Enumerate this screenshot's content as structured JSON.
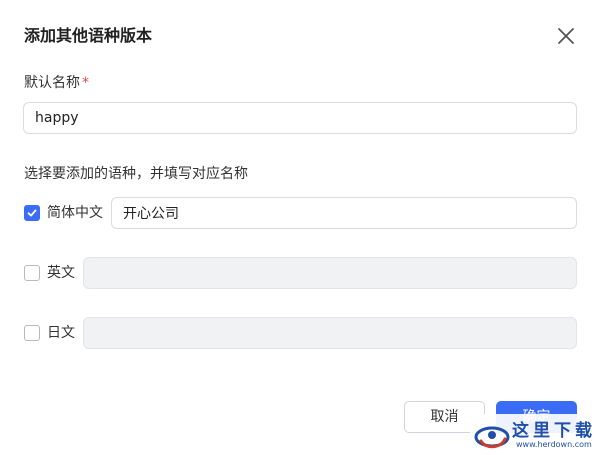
{
  "dialog": {
    "title": "添加其他语种版本",
    "close_icon": "close-icon"
  },
  "default_name": {
    "label": "默认名称",
    "required_mark": "*",
    "value": "happy"
  },
  "languages_section": {
    "instruction": "选择要添加的语种，并填写对应名称",
    "items": [
      {
        "label": "简体中文",
        "checked": true,
        "value": "开心公司",
        "disabled": false
      },
      {
        "label": "英文",
        "checked": false,
        "value": "",
        "disabled": true
      },
      {
        "label": "日文",
        "checked": false,
        "value": "",
        "disabled": true
      }
    ]
  },
  "footer": {
    "cancel_label": "取消",
    "ok_label": "确定"
  },
  "watermark": {
    "text": "这里下载",
    "url": "www.herdown.com"
  },
  "colors": {
    "accent": "#3b6cf6",
    "required": "#e24a4a",
    "disabled_bg": "#f1f2f4"
  }
}
